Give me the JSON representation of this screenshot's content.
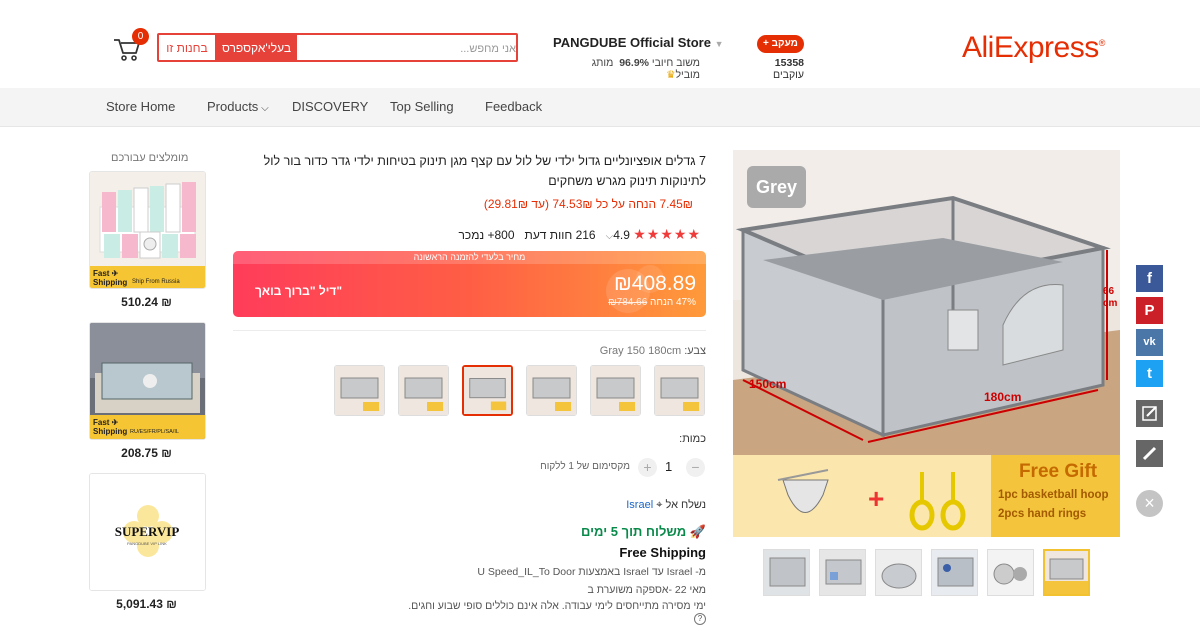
{
  "header": {
    "logo": "AliExpress",
    "cart_count": "0",
    "search": {
      "btn_store": "בחנות זו",
      "btn_ali": "בעלי'אקספרס",
      "placeholder": "אני מחפש..."
    },
    "store": {
      "name": "PANGDUBE Official Store",
      "brand_badge": "מותג מוביל",
      "rating_pct": "96.9%",
      "rating_label": "משוב חיובי",
      "follow_label": "+ מעקב",
      "followers_count": "15358",
      "followers_label": "עוקבים"
    }
  },
  "nav": {
    "items": [
      "Store Home",
      "Products",
      "DISCOVERY",
      "Top Selling",
      "Feedback"
    ]
  },
  "recommended": {
    "title": "מומלצים עבורכם",
    "items": [
      {
        "price": "510.24 ₪",
        "badge": "Fast Shipping",
        "ship_from": "Ship From Russia"
      },
      {
        "price": "208.75 ₪",
        "badge": "Fast Shipping",
        "ship_from": "RU/ES/FR/PL/SA/IL"
      },
      {
        "price": "5,091.43 ₪",
        "logo_text": "SUPERVIP"
      }
    ]
  },
  "product": {
    "title": "7 גדלים אופציונליים גדול ילדי של לול עם קצף מגן תינוק בטיחות ילדי גדר כדור בור לול לתינוקות תינוק מגרש משחקים",
    "coupon": "7.45₪ הנחה על כל 74.53₪ (עד 29.81₪)",
    "rating": "4.9",
    "reviews": "216 חוות דעת",
    "sold": "800+ נמכר",
    "deal": {
      "top_text": "מחיר בלעדי להזמנה הראשונה",
      "price": "₪408.89",
      "old_price": "₪784.66",
      "discount": "47% הנחה",
      "label": "דיל \"ברוך בואך\""
    },
    "color": {
      "label": "צבע:",
      "value": "Gray 150 180cm"
    },
    "quantity": {
      "label": "כמות:",
      "value": "1",
      "max": "מקסימום של 1 ללקוח"
    },
    "ship_to": {
      "label": "נשלח אל",
      "country": "Israel"
    },
    "delivery": {
      "title": "משלוח תוך 5 ימים",
      "free": "Free Shipping",
      "route": "מ- Israel עד Israel באמצעות U Speed_IL_To Door",
      "eta": "מאי 22 -אספקה משוערת ב",
      "note": "ימי מסירה מתייחסים לימי עבודה. אלה אינם כוללים סופי שבוע וחגים."
    }
  },
  "main_image": {
    "tag": "Grey",
    "dim_width": "150cm",
    "dim_length": "180cm",
    "dim_height": "66\ncm",
    "gift_title": "Free Gift",
    "gift_line1": "1pc basketball hoop",
    "gift_line2": "2pcs hand rings"
  },
  "social": {
    "facebook": "f",
    "pinterest": "P",
    "vk": "vk",
    "twitter": "t"
  },
  "colors": {
    "accent": "#e62e04",
    "search_red": "#e6423a",
    "delivery_green": "#0a8a4a"
  }
}
